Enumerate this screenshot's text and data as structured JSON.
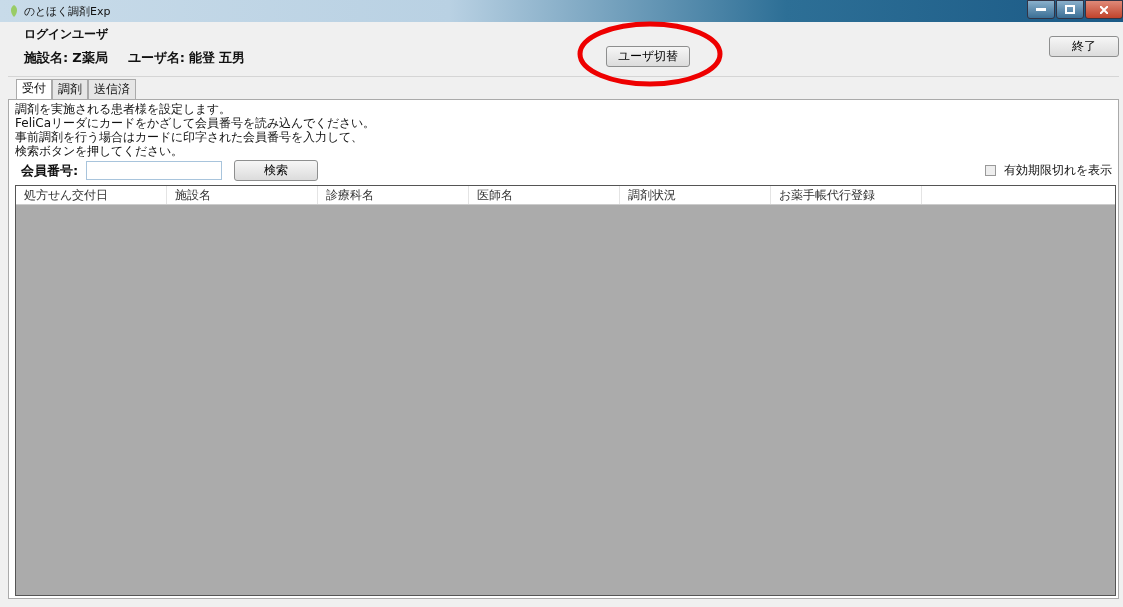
{
  "window": {
    "title": "のとほく調剤Exp"
  },
  "login": {
    "group_title": "ログインユーザ",
    "facility_label": "施設名:",
    "facility": "Z薬局",
    "user_label": "ユーザ名:",
    "user": "能登 五男",
    "switch_button": "ユーザ切替",
    "exit_button": "終了"
  },
  "tabs": [
    {
      "label": "受付",
      "selected": true
    },
    {
      "label": "調剤",
      "selected": false
    },
    {
      "label": "送信済",
      "selected": false
    }
  ],
  "instructions": [
    "調剤を実施される患者様を設定します。",
    "FeliCaリーダにカードをかざして会員番号を読み込んでください。",
    "事前調剤を行う場合はカードに印字された会員番号を入力して、",
    "検索ボタンを押してください。"
  ],
  "member": {
    "label": "会員番号:",
    "search_button": "検索"
  },
  "show_expired": {
    "label": "有効期限切れを表示",
    "checked": false
  },
  "table": {
    "columns": [
      "処方せん交付日",
      "施設名",
      "診療科名",
      "医師名",
      "調剤状況",
      "お薬手帳代行登録"
    ]
  }
}
